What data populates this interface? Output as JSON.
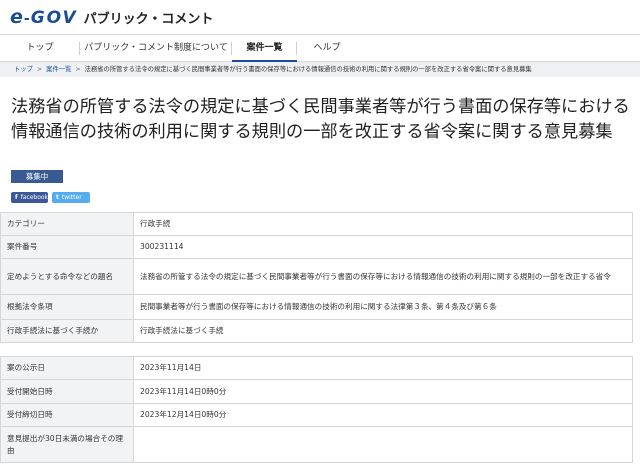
{
  "header": {
    "logo_e": "e",
    "logo_dash": "-",
    "logo_gov": "GOV",
    "site_name": "パブリック・コメント"
  },
  "nav": {
    "items": [
      "トップ",
      "パブリック・コメント制度について",
      "案件一覧",
      "ヘルプ"
    ],
    "active_index": 2
  },
  "breadcrumb": {
    "items": [
      "トップ",
      "案件一覧",
      "法務省の所管する法令の規定に基づく民間事業者等が行う書面の保存等における情報通信の技術の利用に関する規則の一部を改正する省令案に関する意見募集"
    ],
    "separator": ">"
  },
  "page": {
    "title": "法務省の所管する法令の規定に基づく民間事業者等が行う書面の保存等における情報通信の技術の利用に関する規則の一部を改正する省令案に関する意見募集",
    "status": "募集中"
  },
  "share": {
    "facebook_label": "facebook",
    "facebook_icon": "f",
    "twitter_label": "twitter",
    "twitter_icon": "t"
  },
  "details": [
    {
      "label": "カテゴリー",
      "value": "行政手続"
    },
    {
      "label": "案件番号",
      "value": "300231114"
    },
    {
      "label": "定めようとする命令などの題名",
      "value": "法務省の所管する法令の規定に基づく民間事業者等が行う書面の保存等における情報通信の技術の利用に関する規則の一部を改正する省令"
    },
    {
      "label": "根拠法令条項",
      "value": "民間事業者等が行う書面の保存等における情報通信の技術の利用に関する法律第３条、第４条及び第６条"
    },
    {
      "label": "行政手続法に基づく手続か",
      "value": "行政手続法に基づく手続"
    }
  ],
  "schedule": [
    {
      "label": "案の公示日",
      "value": "2023年11月14日"
    },
    {
      "label": "受付開始日時",
      "value": "2023年11月14日0時0分"
    },
    {
      "label": "受付締切日時",
      "value": "2023年12月14日0時0分"
    },
    {
      "label": "意見提出が30日未満の場合その理由",
      "value": ""
    }
  ],
  "colors": {
    "brand": "#1a4c9a",
    "badge": "#3a5a94",
    "facebook": "#3b5998",
    "twitter": "#55acee"
  }
}
